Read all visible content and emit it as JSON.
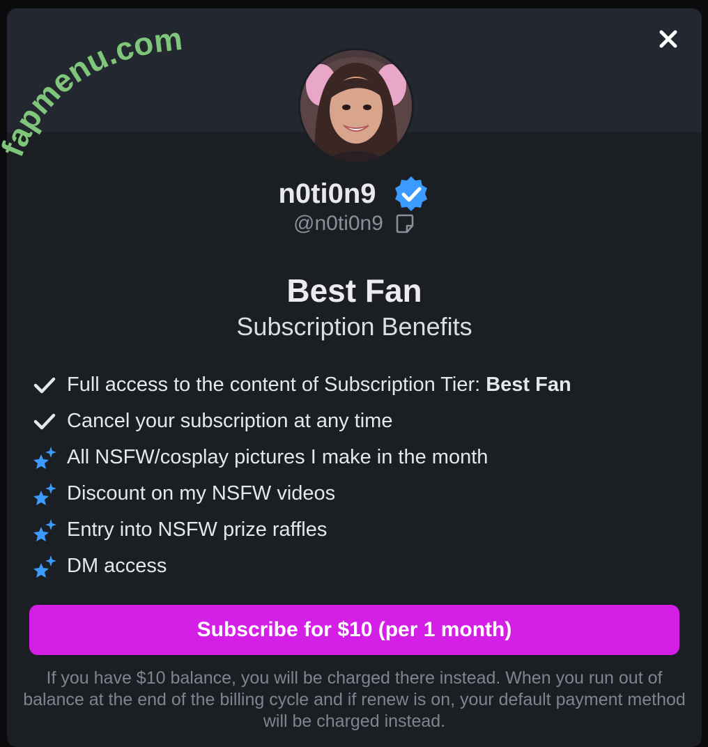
{
  "watermark": {
    "text": "fapmenu.com",
    "color": "#7fc57a"
  },
  "profile": {
    "display_name": "n0ti0n9",
    "handle": "@n0ti0n9",
    "verified_icon": "verified-badge-icon"
  },
  "tier": {
    "name": "Best Fan",
    "subtitle": "Subscription Benefits"
  },
  "benefits": [
    {
      "icon": "checkmark-icon",
      "text": "Full access to the content of Subscription Tier:",
      "bold": "Best Fan"
    },
    {
      "icon": "checkmark-icon",
      "text": "Cancel your subscription at any time"
    },
    {
      "icon": "sparkle-stars-icon",
      "text": "All NSFW/cosplay pictures I make in the month"
    },
    {
      "icon": "sparkle-stars-icon",
      "text": "Discount on my NSFW videos"
    },
    {
      "icon": "sparkle-stars-icon",
      "text": "Entry into NSFW prize raffles"
    },
    {
      "icon": "sparkle-stars-icon",
      "text": "DM access"
    }
  ],
  "subscribe_button": {
    "label": "Subscribe for $10 (per 1 month)",
    "color": "#d41fe6"
  },
  "notice": "If you have $10 balance, you will be charged there instead. When you run out of balance at the end of the billing cycle and if renew is on, your default payment method will be charged instead.",
  "colors": {
    "modal_bg": "#1b1e23",
    "banner_bg": "#232830",
    "accent_blue": "#3b9bff"
  }
}
